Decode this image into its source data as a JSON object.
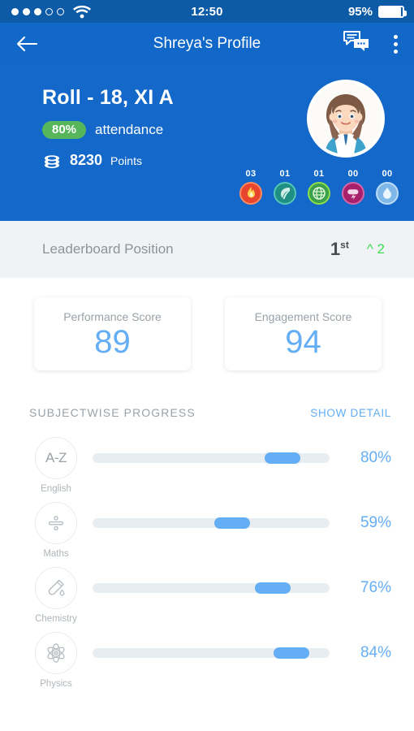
{
  "status_bar": {
    "signal_dots_filled": 3,
    "signal_dots_total": 5,
    "wifi_icon": "wifi-icon",
    "time": "12:50",
    "battery_percent": "95%"
  },
  "app_bar": {
    "back_icon": "back-arrow-icon",
    "title": "Shreya's Profile",
    "chat_icon": "chat-bubbles-icon",
    "menu_icon": "overflow-menu-icon"
  },
  "profile": {
    "roll": "Roll - 18, XI A",
    "attendance_value": "80%",
    "attendance_label": "attendance",
    "points_icon": "coin-stack-icon",
    "points_value": "8230",
    "points_label": "Points",
    "avatar_icon": "student-avatar",
    "badges": [
      {
        "count": "03",
        "icon": "fire-badge-icon",
        "color": "#e8442e",
        "ring": "#ff7a45"
      },
      {
        "count": "01",
        "icon": "leaf-badge-icon",
        "color": "#1f8e83",
        "ring": "#4dc3b4"
      },
      {
        "count": "01",
        "icon": "globe-badge-icon",
        "color": "#3aa04a",
        "ring": "#7fd63f"
      },
      {
        "count": "00",
        "icon": "lightning-badge-icon",
        "color": "#a8206b",
        "ring": "#d45a9a"
      },
      {
        "count": "00",
        "icon": "water-drop-badge-icon",
        "color": "#7fb8e8",
        "ring": "#aed5f2"
      }
    ]
  },
  "leaderboard": {
    "label": "Leaderboard Position",
    "position": "1",
    "position_suffix": "st",
    "delta": "^ 2",
    "delta_color": "#3ddc52"
  },
  "score_cards": [
    {
      "label": "Performance Score",
      "value": "89"
    },
    {
      "label": "Engagement Score",
      "value": "94"
    }
  ],
  "subjectwise": {
    "title": "SUBJECTWISE PROGRESS",
    "action": "SHOW DETAIL",
    "accent_color": "#63aef5",
    "track_color": "#e7edf1",
    "rows": [
      {
        "name": "English",
        "icon": "alphabet-a-z-icon",
        "icon_text": "A-Z",
        "value": 80,
        "percent_label": "80%"
      },
      {
        "name": "Maths",
        "icon": "division-sign-icon",
        "icon_text": "",
        "value": 59,
        "percent_label": "59%"
      },
      {
        "name": "Chemistry",
        "icon": "test-tube-icon",
        "icon_text": "",
        "value": 76,
        "percent_label": "76%"
      },
      {
        "name": "Physics",
        "icon": "atom-icon",
        "icon_text": "",
        "value": 84,
        "percent_label": "84%"
      }
    ]
  }
}
